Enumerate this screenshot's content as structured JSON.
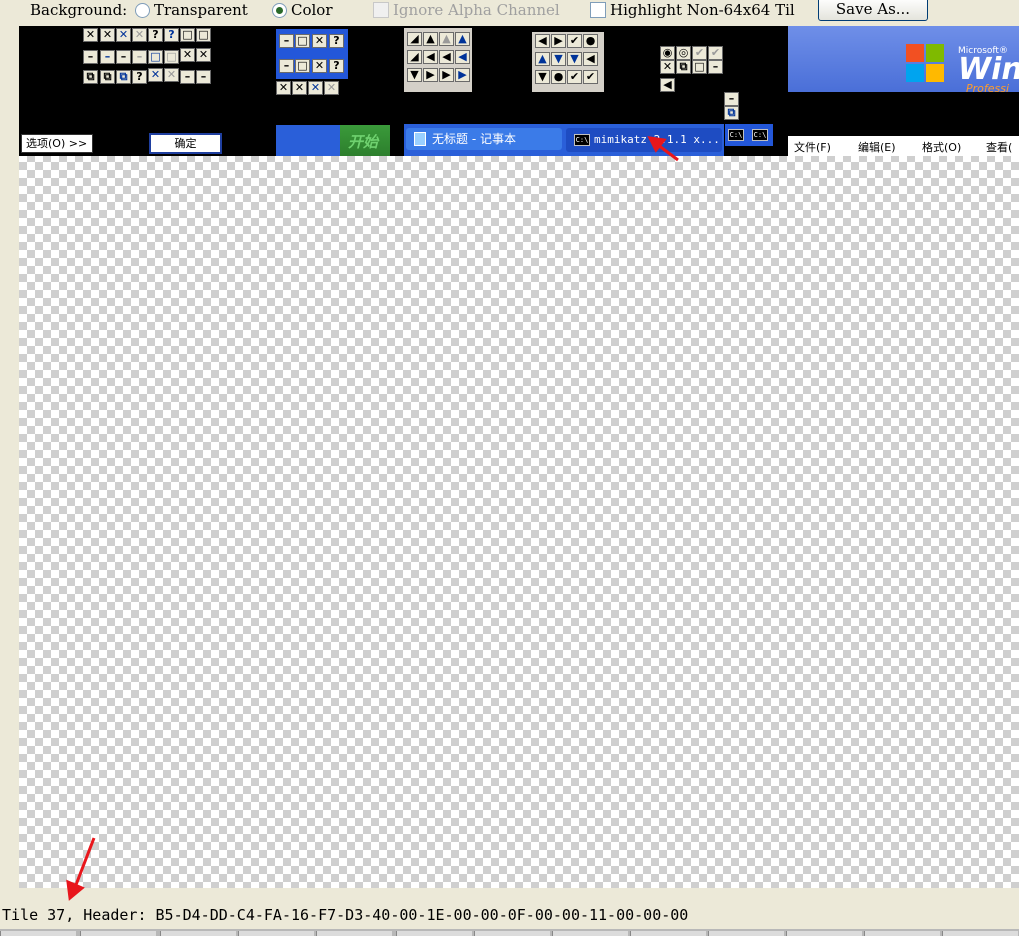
{
  "toolbar": {
    "background_label": "Background:",
    "transparent_label": "Transparent",
    "color_label": "Color",
    "ignore_alpha_label": "Ignore Alpha Channel",
    "highlight_label": "Highlight Non-64x64 Til",
    "save_as_label": "Save As...",
    "selected_background": "Color"
  },
  "tiles": {
    "options_button": "选项(O) >>",
    "ok_button": "确定",
    "start_button": "开始",
    "taskbar_items": [
      "无标题 - 记事本",
      "mimikatz 2.1.1 x..."
    ],
    "cmd_icon_text": "C:\\",
    "menu_items": [
      "文件(F)",
      "编辑(E)",
      "格式(O)",
      "查看("
    ],
    "xp_microsoft": "Microsoft®",
    "xp_windows": "Wind",
    "xp_professional": "Professi"
  },
  "status": {
    "text": "Tile 37, Header: B5-D4-DD-C4-FA-16-F7-D3-40-00-1E-00-00-0F-00-00-11-00-00-00"
  },
  "colors": {
    "annotation_arrow": "#e8161c",
    "xp_taskbar_blue": "#2a5fd9"
  }
}
